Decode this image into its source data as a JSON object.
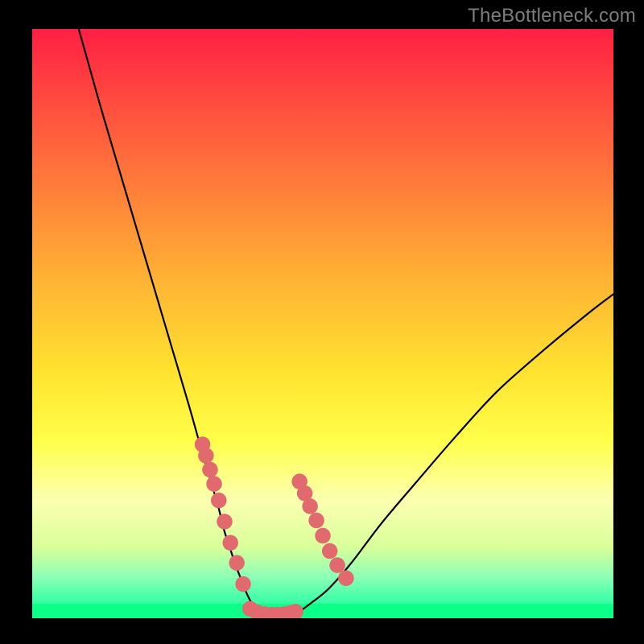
{
  "watermark": "TheBottleneck.com",
  "chart_data": {
    "type": "line",
    "title": "",
    "xlabel": "",
    "ylabel": "",
    "xlim": [
      0,
      100
    ],
    "ylim": [
      0,
      100
    ],
    "grid": false,
    "legend": false,
    "series": [
      {
        "name": "bottleneck-curve",
        "x": [
          8,
          10,
          12,
          15,
          18,
          21,
          24,
          27,
          29,
          30.5,
          32,
          33,
          34,
          35,
          36.2,
          37,
          37.8,
          38.5,
          40,
          42,
          44,
          46,
          48,
          51,
          55,
          60,
          66,
          73,
          80,
          88,
          96,
          100
        ],
        "y": [
          100,
          93,
          86,
          76,
          66,
          56,
          46,
          36,
          29,
          24,
          19,
          15,
          12,
          9,
          6,
          4,
          2.5,
          1.5,
          0.8,
          0.5,
          0.5,
          1.2,
          2.6,
          5,
          9.5,
          16,
          23,
          31,
          38.5,
          45.5,
          52,
          55
        ]
      }
    ],
    "markers_left": {
      "name": "left-cluster-dots",
      "x": [
        29.3,
        29.9,
        30.6,
        31.3,
        32.1,
        33.1,
        34.1,
        35.2,
        36.3
      ],
      "y": [
        29.5,
        27.6,
        25.2,
        22.8,
        20.0,
        16.4,
        12.8,
        9.4,
        5.8
      ]
    },
    "markers_right": {
      "name": "right-cluster-dots",
      "x": [
        46.0,
        46.9,
        47.8,
        48.9,
        50.0,
        51.2,
        52.5,
        54.0
      ],
      "y": [
        23.2,
        21.2,
        19.0,
        16.6,
        14.0,
        11.4,
        9.0,
        6.8
      ]
    },
    "markers_bottom": {
      "name": "bottom-dots",
      "x": [
        37.5,
        38.7,
        40.0,
        41.2,
        42.3,
        43.4,
        44.5,
        45.3
      ],
      "y": [
        1.6,
        1.0,
        0.7,
        0.6,
        0.6,
        0.7,
        0.9,
        1.1
      ]
    },
    "marker_radius_pct": 1.35
  }
}
